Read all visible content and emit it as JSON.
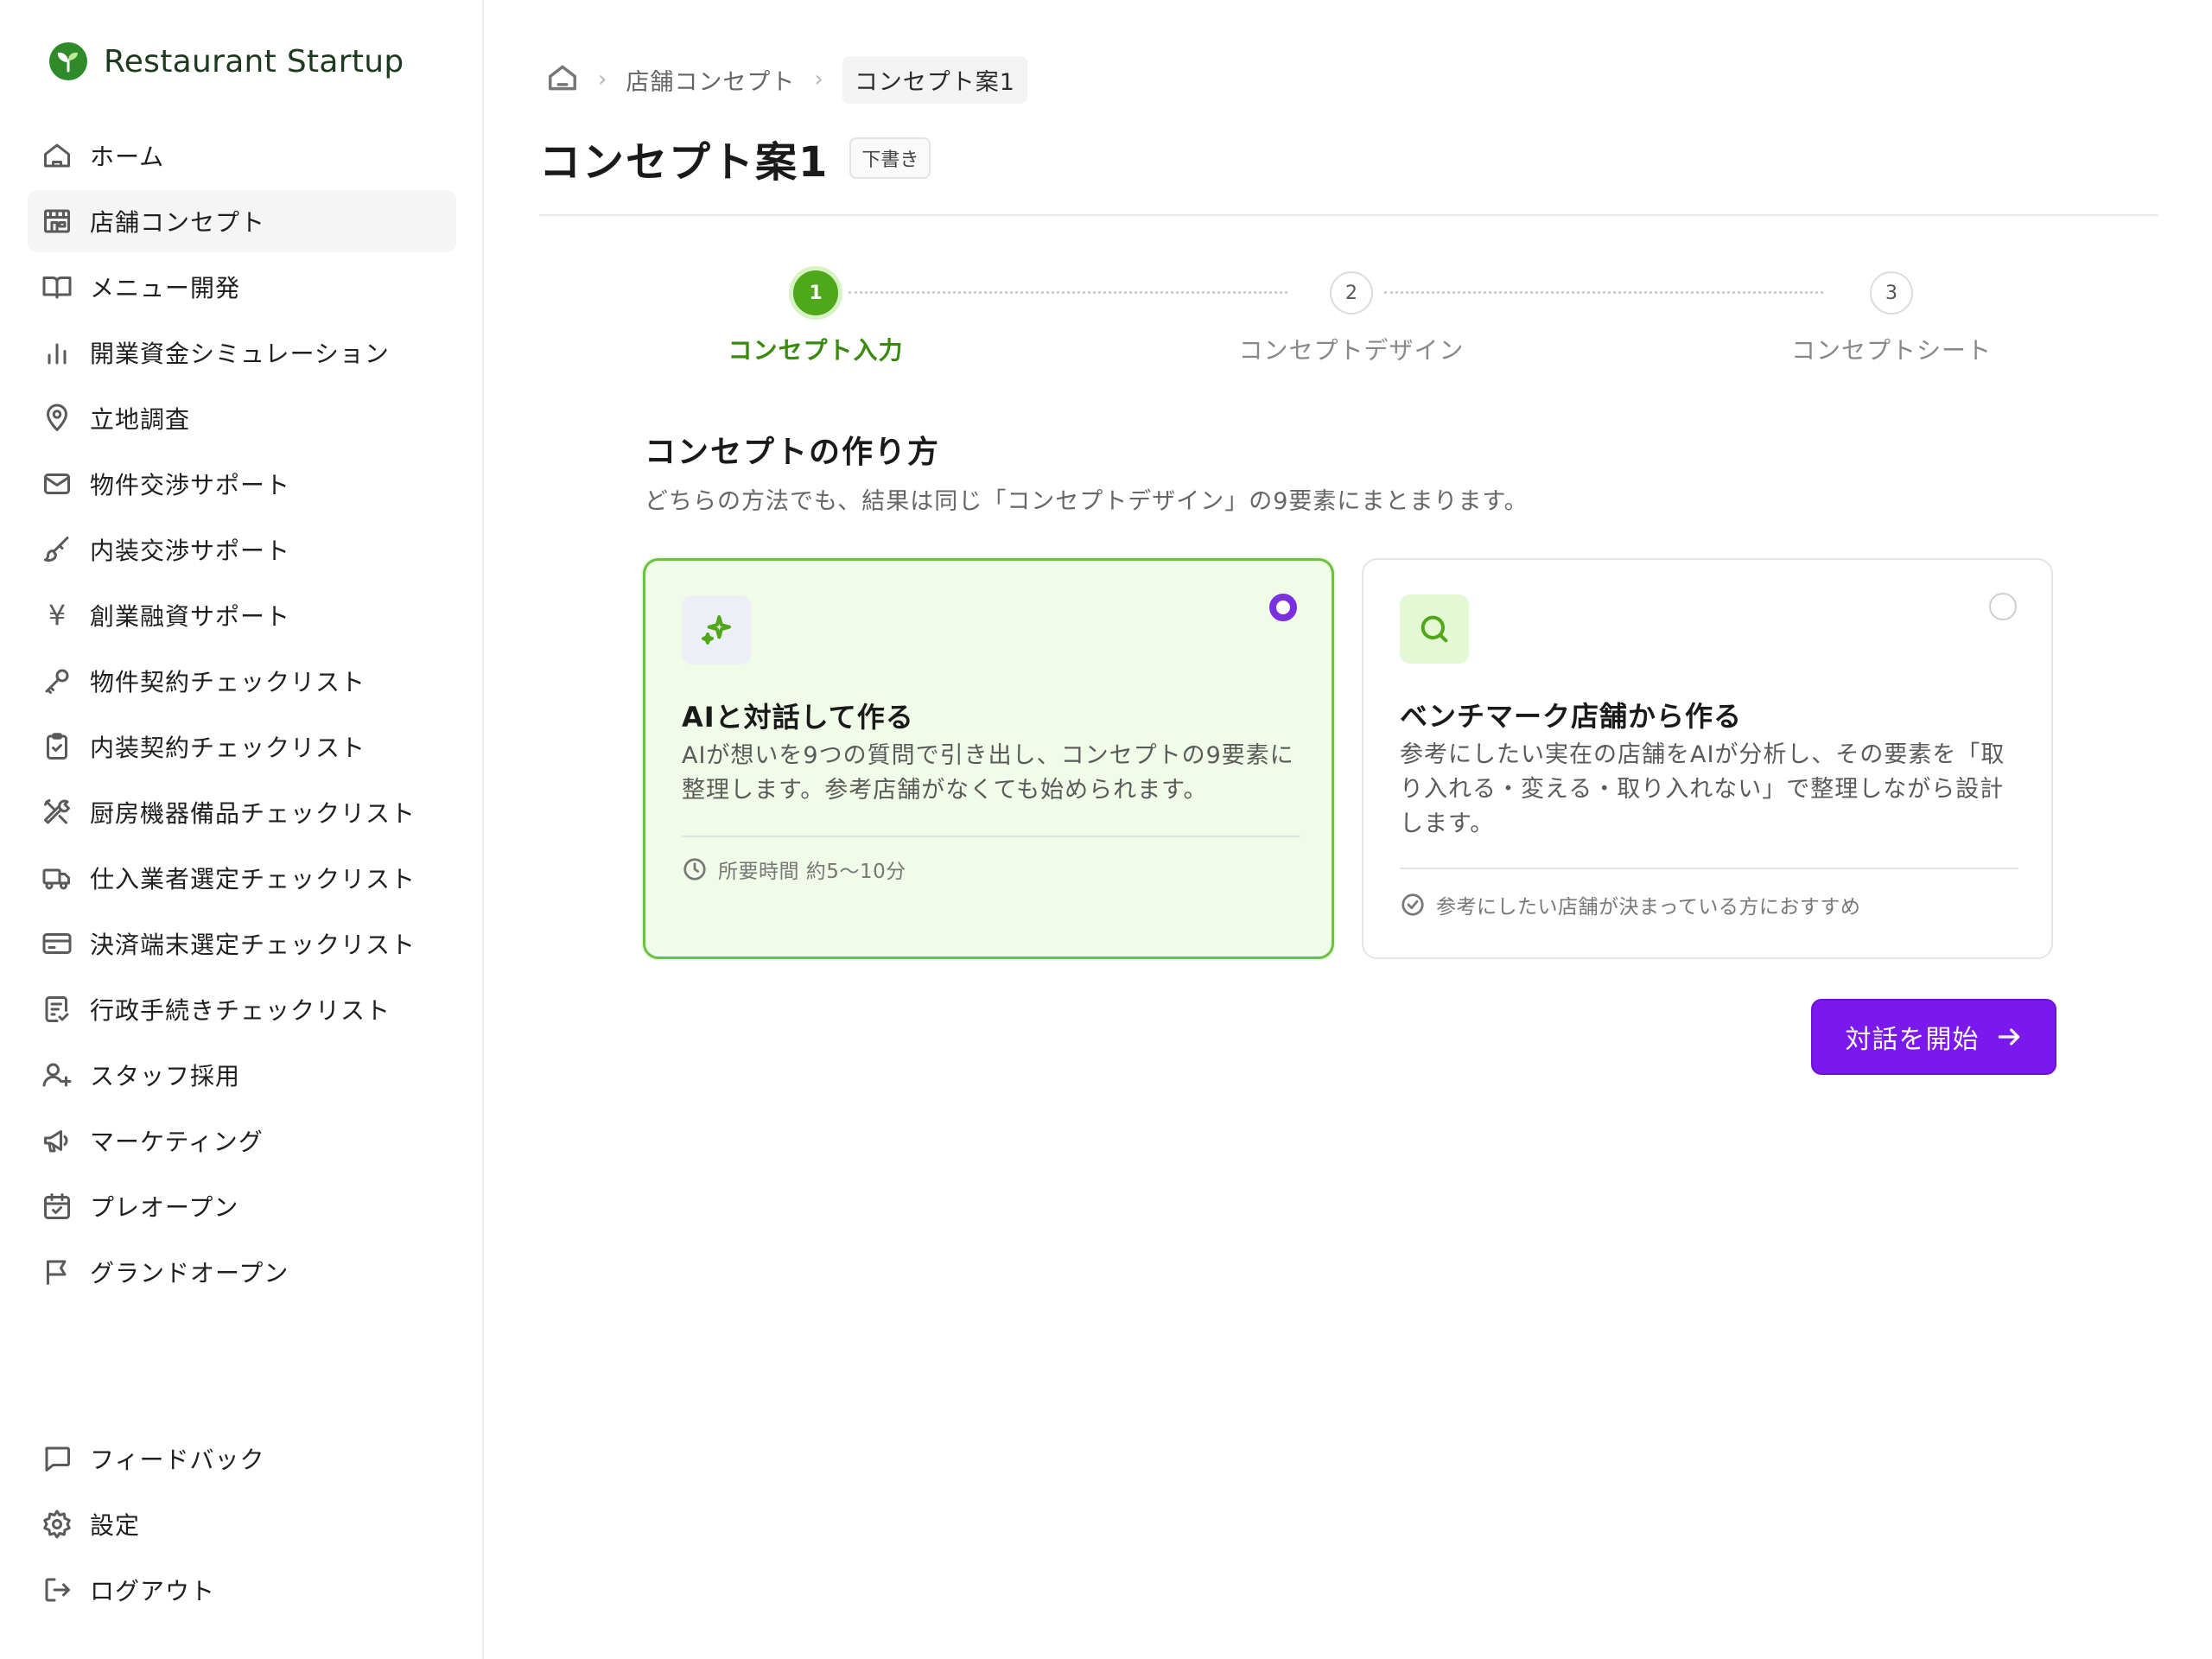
{
  "brand": {
    "name": "Restaurant Startup",
    "logo_icon": "sprout-logo-icon",
    "accent": "#2f8a2a"
  },
  "sidebar": {
    "items": [
      {
        "label": "ホーム",
        "icon": "home-icon"
      },
      {
        "label": "店舗コンセプト",
        "icon": "store-icon",
        "active": true
      },
      {
        "label": "メニュー開発",
        "icon": "book-open-icon"
      },
      {
        "label": "開業資金シミュレーション",
        "icon": "bar-chart-icon"
      },
      {
        "label": "立地調査",
        "icon": "map-pin-icon"
      },
      {
        "label": "物件交渉サポート",
        "icon": "mail-icon"
      },
      {
        "label": "内装交渉サポート",
        "icon": "paintbrush-icon"
      },
      {
        "label": "創業融資サポート",
        "icon": "yen-icon",
        "glyph": "¥"
      },
      {
        "label": "物件契約チェックリスト",
        "icon": "key-icon"
      },
      {
        "label": "内装契約チェックリスト",
        "icon": "clipboard-check-icon"
      },
      {
        "label": "厨房機器備品チェックリスト",
        "icon": "tools-icon"
      },
      {
        "label": "仕入業者選定チェックリスト",
        "icon": "truck-icon"
      },
      {
        "label": "決済端末選定チェックリスト",
        "icon": "credit-card-icon"
      },
      {
        "label": "行政手続きチェックリスト",
        "icon": "document-check-icon"
      },
      {
        "label": "スタッフ採用",
        "icon": "user-plus-icon"
      },
      {
        "label": "マーケティング",
        "icon": "megaphone-icon"
      },
      {
        "label": "プレオープン",
        "icon": "calendar-check-icon"
      },
      {
        "label": "グランドオープン",
        "icon": "flag-icon"
      }
    ],
    "bottom_items": [
      {
        "label": "フィードバック",
        "icon": "message-square-icon"
      },
      {
        "label": "設定",
        "icon": "gear-icon"
      },
      {
        "label": "ログアウト",
        "icon": "logout-icon"
      }
    ]
  },
  "breadcrumb": {
    "home_icon": "home-icon",
    "items": [
      "店舗コンセプト",
      "コンセプト案1"
    ]
  },
  "page": {
    "title": "コンセプト案1",
    "status_badge": "下書き"
  },
  "stepper": {
    "steps": [
      {
        "number": "1",
        "label": "コンセプト入力",
        "state": "active"
      },
      {
        "number": "2",
        "label": "コンセプトデザイン",
        "state": "upcoming"
      },
      {
        "number": "3",
        "label": "コンセプトシート",
        "state": "upcoming"
      }
    ],
    "active_color": "#4ea819"
  },
  "section": {
    "title": "コンセプトの作り方",
    "subtitle": "どちらの方法でも、結果は同じ「コンセプトデザイン」の9要素にまとまります。"
  },
  "options": [
    {
      "icon": "sparkles-icon",
      "title": "AIと対話して作る",
      "description": "AIが想いを9つの質問で引き出し、コンセプトの9要素に整理します。参考店舗がなくても始められます。",
      "footer_icon": "clock-icon",
      "footer": "所要時間 約5〜10分",
      "selected": true
    },
    {
      "icon": "search-icon",
      "title": "ベンチマーク店舗から作る",
      "description": "参考にしたい実在の店舗をAIが分析し、その要素を「取り入れる・変える・取り入れない」で整理しながら設計します。",
      "footer_icon": "check-circle-icon",
      "footer": "参考にしたい店舗が決まっている方におすすめ",
      "selected": false
    }
  ],
  "actions": {
    "start_label": "対話を開始",
    "start_icon": "arrow-right-icon",
    "button_color": "#7a18ee"
  }
}
